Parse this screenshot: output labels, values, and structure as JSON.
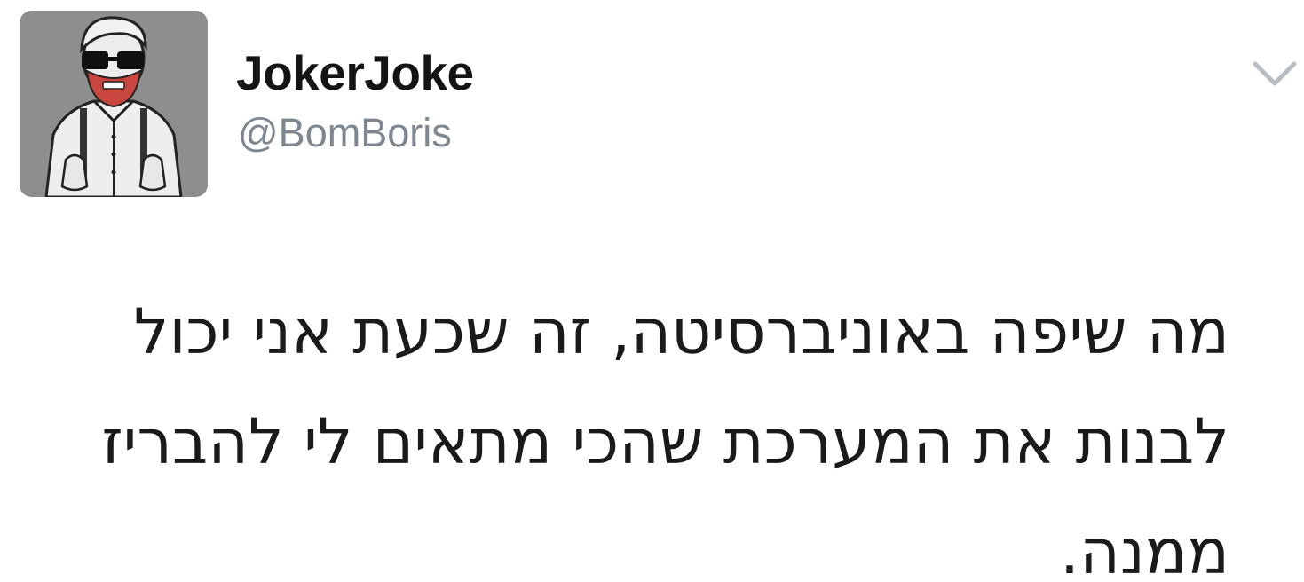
{
  "tweet": {
    "display_name": "JokerJoke",
    "handle": "@BomBoris",
    "text": "מה שיפה באוניברסיטה, זה שכעת אני יכול לבנות את המערכת שהכי מתאים לי להבריז ממנה."
  },
  "icons": {
    "avatar": "profile-avatar",
    "menu": "chevron-down-icon"
  },
  "colors": {
    "display_name": "#141414",
    "handle": "#7e878f",
    "text": "#1a1a1a",
    "chevron": "#b8bec4"
  }
}
